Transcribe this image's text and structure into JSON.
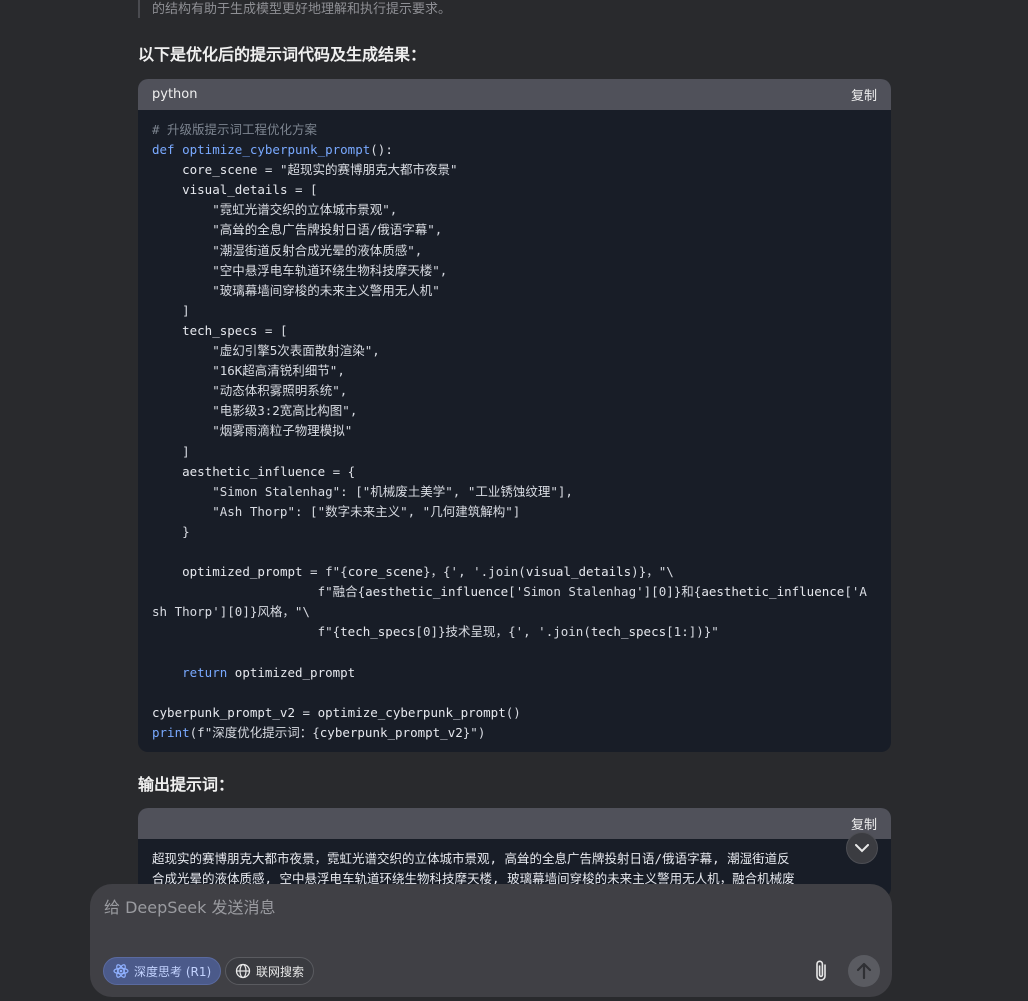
{
  "quote_text": "的结构有助于生成模型更好地理解和执行提示要求。",
  "section1_heading": "以下是优化后的提示词代码及生成结果：",
  "code_block": {
    "language": "python",
    "copy_label": "复制",
    "lines": [
      [
        [
          "c-com",
          "# 升级版提示词工程优化方案"
        ]
      ],
      [
        [
          "c-kw",
          "def "
        ],
        [
          "c-fn",
          "optimize_cyberpunk_prompt"
        ],
        [
          "",
          "():"
        ]
      ],
      [
        [
          "",
          "    "
        ],
        [
          "c-var",
          "core_scene"
        ],
        [
          "",
          " = "
        ],
        [
          "c-str",
          "\"超现实的赛博朋克大都市夜景\""
        ]
      ],
      [
        [
          "",
          "    "
        ],
        [
          "c-var",
          "visual_details"
        ],
        [
          "",
          " = ["
        ]
      ],
      [
        [
          "c-str",
          "        \"霓虹光谱交织的立体城市景观\","
        ]
      ],
      [
        [
          "c-str",
          "        \"高耸的全息广告牌投射日语/俄语字幕\","
        ]
      ],
      [
        [
          "c-str",
          "        \"潮湿街道反射合成光晕的液体质感\","
        ]
      ],
      [
        [
          "c-str",
          "        \"空中悬浮电车轨道环绕生物科技摩天楼\","
        ]
      ],
      [
        [
          "c-str",
          "        \"玻璃幕墙间穿梭的未来主义警用无人机\""
        ]
      ],
      [
        [
          "",
          "    ]"
        ]
      ],
      [
        [
          "",
          "    "
        ],
        [
          "c-var",
          "tech_specs"
        ],
        [
          "",
          " = ["
        ]
      ],
      [
        [
          "c-str",
          "        \"虚幻引擎5次表面散射渲染\","
        ]
      ],
      [
        [
          "c-str",
          "        \"16K超高清锐利细节\","
        ]
      ],
      [
        [
          "c-str",
          "        \"动态体积雾照明系统\","
        ]
      ],
      [
        [
          "c-str",
          "        \"电影级3:2宽高比构图\","
        ]
      ],
      [
        [
          "c-str",
          "        \"烟雾雨滴粒子物理模拟\""
        ]
      ],
      [
        [
          "",
          "    ]"
        ]
      ],
      [
        [
          "",
          "    "
        ],
        [
          "c-var",
          "aesthetic_influence"
        ],
        [
          "",
          " = {"
        ]
      ],
      [
        [
          "c-str",
          "        \"Simon Stalenhag\""
        ],
        [
          "",
          ": ["
        ],
        [
          "c-str",
          "\"机械废土美学\", \"工业锈蚀纹理\""
        ],
        [
          "",
          "],"
        ]
      ],
      [
        [
          "c-str",
          "        \"Ash Thorp\""
        ],
        [
          "",
          ": ["
        ],
        [
          "c-str",
          "\"数字未来主义\", \"几何建筑解构\""
        ],
        [
          "",
          "]"
        ]
      ],
      [
        [
          "",
          "    }"
        ]
      ],
      [
        [
          "",
          ""
        ]
      ],
      [
        [
          "",
          "    "
        ],
        [
          "c-var",
          "optimized_prompt"
        ],
        [
          "",
          " = "
        ],
        [
          "c-str",
          "f\""
        ],
        [
          "",
          "{"
        ],
        [
          "c-var",
          "core_scene"
        ],
        [
          "",
          "}"
        ],
        [
          "c-str",
          "，"
        ],
        [
          "",
          "{"
        ],
        [
          "c-str",
          "', '"
        ],
        [
          "",
          ".join("
        ],
        [
          "c-var",
          "visual_details"
        ],
        [
          "",
          ")}"
        ],
        [
          "c-str",
          "，\"\\"
        ]
      ],
      [
        [
          "c-str",
          "                      f\"融合"
        ],
        [
          "",
          "{"
        ],
        [
          "c-var",
          "aesthetic_influence"
        ],
        [
          "",
          "["
        ],
        [
          "c-str",
          "'Simon Stalenhag'"
        ],
        [
          "",
          "]["
        ],
        [
          "c-num",
          "0"
        ],
        [
          "",
          "]}"
        ],
        [
          "c-str",
          "和"
        ],
        [
          "",
          "{"
        ],
        [
          "c-var",
          "aesthetic_influence"
        ],
        [
          "",
          "["
        ],
        [
          "c-str",
          "'A"
        ]
      ],
      [
        [
          "c-str",
          "sh Thorp'"
        ],
        [
          "",
          "]["
        ],
        [
          "c-num",
          "0"
        ],
        [
          "",
          "]}"
        ],
        [
          "c-str",
          "风格，\"\\"
        ]
      ],
      [
        [
          "c-str",
          "                      f\""
        ],
        [
          "",
          "{"
        ],
        [
          "c-var",
          "tech_specs"
        ],
        [
          "",
          "["
        ],
        [
          "c-num",
          "0"
        ],
        [
          "",
          "]}"
        ],
        [
          "c-str",
          "技术呈现，"
        ],
        [
          "",
          "{"
        ],
        [
          "c-str",
          "', '"
        ],
        [
          "",
          ".join("
        ],
        [
          "c-var",
          "tech_specs"
        ],
        [
          "",
          "["
        ],
        [
          "c-num",
          "1"
        ],
        [
          "",
          ":])}"
        ],
        [
          "c-str",
          "\""
        ]
      ],
      [
        [
          "",
          ""
        ]
      ],
      [
        [
          "",
          "    "
        ],
        [
          "c-kw",
          "return "
        ],
        [
          "c-var",
          "optimized_prompt"
        ]
      ],
      [
        [
          "",
          ""
        ]
      ],
      [
        [
          "c-var",
          "cyberpunk_prompt_v2"
        ],
        [
          "",
          " = "
        ],
        [
          "c-var",
          "optimize_cyberpunk_prompt"
        ],
        [
          "",
          "()"
        ]
      ],
      [
        [
          "c-kw",
          "print"
        ],
        [
          "",
          "("
        ],
        [
          "c-str",
          "f\"深度优化提示词："
        ],
        [
          "",
          "{"
        ],
        [
          "c-var",
          "cyberpunk_prompt_v2"
        ],
        [
          "",
          "}"
        ],
        [
          "c-str",
          "\""
        ],
        [
          "",
          ")"
        ]
      ]
    ]
  },
  "section2_heading": "输出提示词：",
  "output_block": {
    "copy_label": "复制",
    "line1": "超现实的赛博朋克大都市夜景，霓虹光谱交织的立体城市景观, 高耸的全息广告牌投射日语/俄语字幕, 潮湿街道反",
    "line2": "合成光晕的液体质感, 空中悬浮电车轨道环绕生物科技摩天楼, 玻璃幕墙间穿梭的未来主义警用无人机，融合机械废"
  },
  "composer": {
    "placeholder": "给 DeepSeek 发送消息",
    "deep_think_label": "深度思考 (R1)",
    "web_search_label": "联网搜索"
  },
  "icons": {
    "scroll_down": "chevron-down-icon",
    "deep_think": "atom-icon",
    "web_search": "globe-icon",
    "attach": "paperclip-icon",
    "send": "arrow-up-icon"
  },
  "colors": {
    "background": "#292a2d",
    "code_bg": "#181d27",
    "code_header": "#50515a",
    "keyword": "#79a9ff",
    "comment": "#7d8590",
    "deep_think_active": "#4b5a8a"
  }
}
